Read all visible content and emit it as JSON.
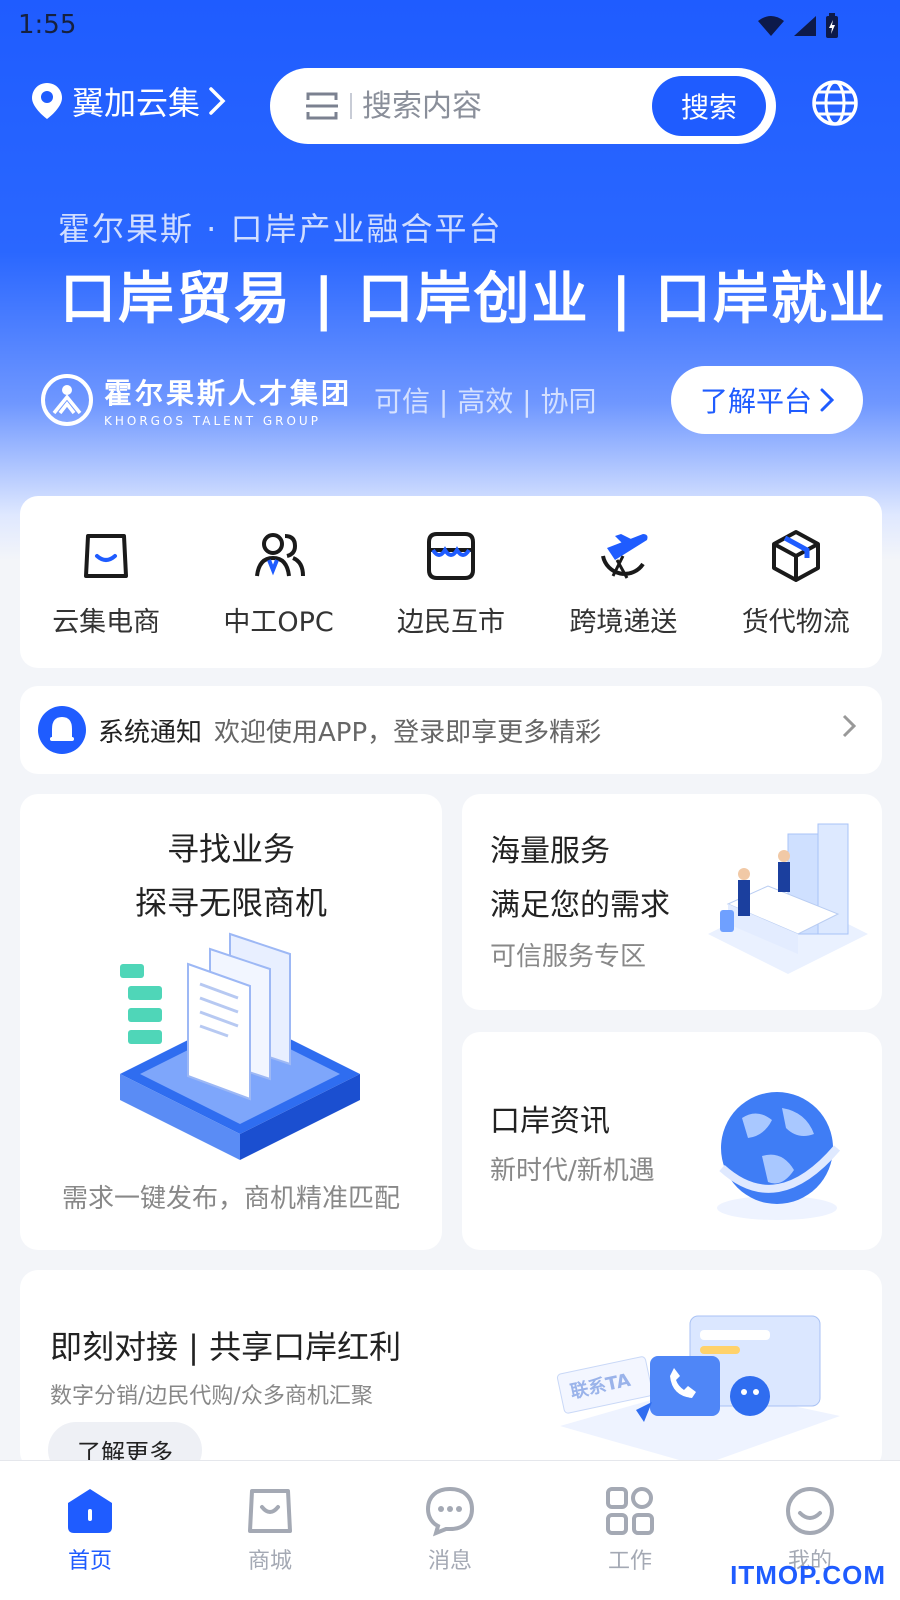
{
  "status_bar": {
    "time": "1:55"
  },
  "topbar": {
    "location": "翼加云集",
    "search_placeholder": "搜索内容",
    "search_button": "搜索"
  },
  "banner": {
    "subtitle": "霍尔果斯 · 口岸产业融合平台",
    "title": "口岸贸易 | 口岸创业 | 口岸就业",
    "brand_cn": "霍尔果斯人才集团",
    "brand_en": "KHORGOS TALENT GROUP",
    "slogan": "可信 | 高效 | 协同",
    "learn_button": "了解平台"
  },
  "categories": [
    {
      "label": "云集电商",
      "icon": "shopping-bag-icon"
    },
    {
      "label": "中工OPC",
      "icon": "users-icon"
    },
    {
      "label": "边民互市",
      "icon": "store-icon"
    },
    {
      "label": "跨境递送",
      "icon": "plane-globe-icon"
    },
    {
      "label": "货代物流",
      "icon": "package-icon"
    }
  ],
  "notice": {
    "label": "系统通知",
    "message": "欢迎使用APP，登录即享更多精彩"
  },
  "cards": {
    "business": {
      "line1": "寻找业务",
      "line2": "探寻无限商机",
      "desc": "需求一键发布，商机精准匹配"
    },
    "services": {
      "line1": "海量服务",
      "line2": "满足您的需求",
      "desc": "可信服务专区"
    },
    "news": {
      "title": "口岸资讯",
      "desc": "新时代/新机遇"
    },
    "connect": {
      "title": "即刻对接 | 共享口岸红利",
      "desc": "数字分销/边民代购/众多商机汇聚",
      "button": "了解更多",
      "illu_text": "联系TA"
    }
  },
  "tabs": [
    {
      "label": "首页",
      "icon": "home-icon",
      "active": true
    },
    {
      "label": "商城",
      "icon": "shop-bag-icon",
      "active": false
    },
    {
      "label": "消息",
      "icon": "chat-icon",
      "active": false
    },
    {
      "label": "工作",
      "icon": "grid-icon",
      "active": false
    },
    {
      "label": "我的",
      "icon": "smile-icon",
      "active": false
    }
  ],
  "watermark": "ITMOP.COM",
  "colors": {
    "primary": "#1f5cff",
    "background": "#f3f5f9"
  }
}
